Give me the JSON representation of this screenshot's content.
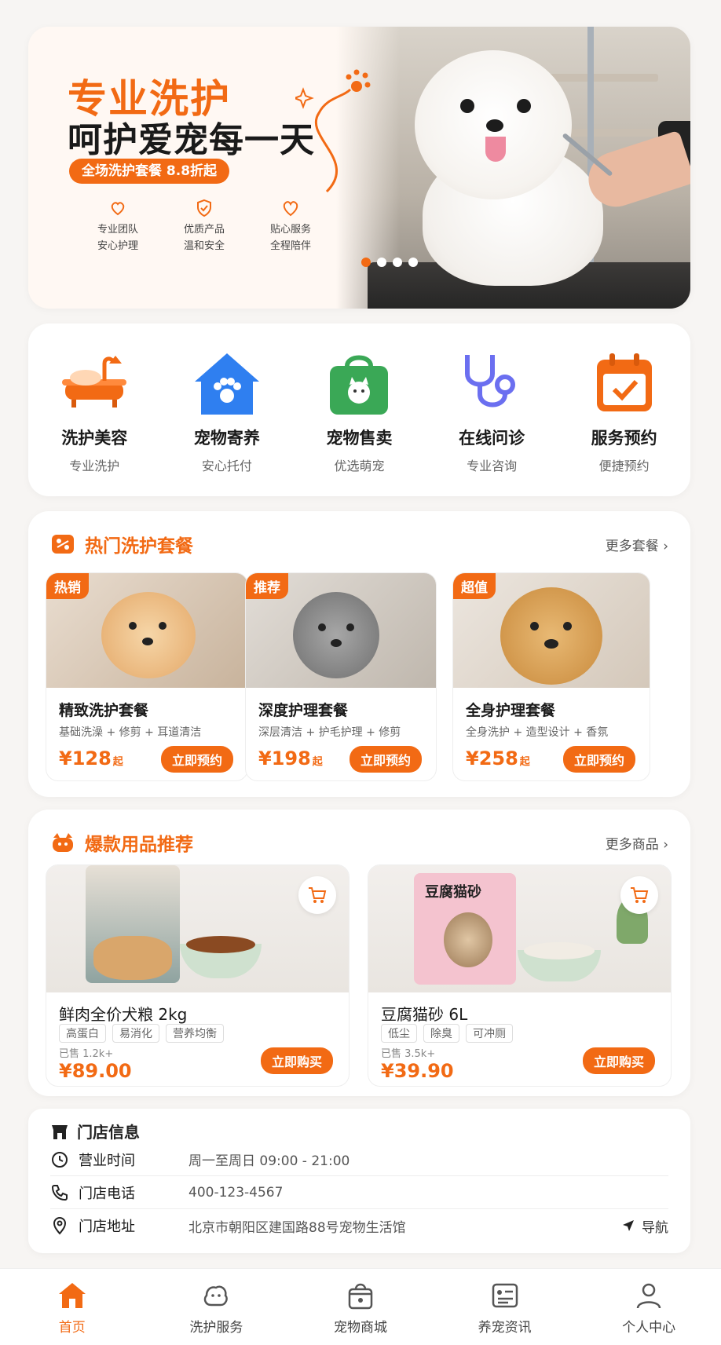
{
  "banner": {
    "title_line1": "专业洗护",
    "title_line2": "呵护爱宠每一天",
    "promo": "全场洗护套餐 8.8折起",
    "features": [
      {
        "icon": "heart-hand-icon",
        "line1": "专业团队",
        "line2": "安心护理"
      },
      {
        "icon": "shield-check-icon",
        "line1": "优质产品",
        "line2": "温和安全"
      },
      {
        "icon": "heart-icon",
        "line1": "贴心服务",
        "line2": "全程陪伴"
      }
    ],
    "slide_count": 4,
    "active_slide": 1
  },
  "categories": [
    {
      "icon": "bathtub-icon",
      "title": "洗护美容",
      "subtitle": "专业洗护"
    },
    {
      "icon": "pet-house-icon",
      "title": "宠物寄养",
      "subtitle": "安心托付"
    },
    {
      "icon": "pet-shop-bag-icon",
      "title": "宠物售卖",
      "subtitle": "优选萌宠"
    },
    {
      "icon": "stethoscope-icon",
      "title": "在线问诊",
      "subtitle": "专业咨询"
    },
    {
      "icon": "calendar-check-icon",
      "title": "服务预约",
      "subtitle": "便捷预约"
    }
  ],
  "packages_section": {
    "title": "热门洗护套餐",
    "more": "更多套餐",
    "items": [
      {
        "tag": "热销",
        "name": "精致洗护套餐",
        "desc": "基础洗澡 + 修剪 + 耳道清洁",
        "price": "¥128",
        "price_suffix": "起",
        "button": "立即预约"
      },
      {
        "tag": "推荐",
        "name": "深度护理套餐",
        "desc": "深层清洁 + 护毛护理 + 修剪",
        "price": "¥198",
        "price_suffix": "起",
        "button": "立即预约"
      },
      {
        "tag": "超值",
        "name": "全身护理套餐",
        "desc": "全身洗护 + 造型设计 + 香氛",
        "price": "¥258",
        "price_suffix": "起",
        "button": "立即预约"
      }
    ]
  },
  "products_section": {
    "title": "爆款用品推荐",
    "more": "更多商品",
    "items": [
      {
        "name": "鲜肉全价犬粮 2kg",
        "tags": [
          "高蛋白",
          "易消化",
          "营养均衡"
        ],
        "sold": "已售 1.2k+",
        "price": "¥89.00",
        "button": "立即购买"
      },
      {
        "name": "豆腐猫砂 6L",
        "tags": [
          "低尘",
          "除臭",
          "可冲厕"
        ],
        "sold": "已售 3.5k+",
        "price": "¥39.90",
        "button": "立即购买",
        "package_text": "豆腐猫砂"
      }
    ]
  },
  "store": {
    "title": "门店信息",
    "hours_label": "营业时间",
    "hours_value": "周一至周日  09:00 - 21:00",
    "phone_label": "门店电话",
    "phone_value": "400-123-4567",
    "address_label": "门店地址",
    "address_value": "北京市朝阳区建国路88号宠物生活馆",
    "navigate": "导航"
  },
  "tabbar": [
    {
      "icon": "home-icon",
      "label": "首页",
      "active": true
    },
    {
      "icon": "grooming-icon",
      "label": "洗护服务",
      "active": false
    },
    {
      "icon": "shop-icon",
      "label": "宠物商城",
      "active": false
    },
    {
      "icon": "news-icon",
      "label": "养宠资讯",
      "active": false
    },
    {
      "icon": "user-icon",
      "label": "个人中心",
      "active": false
    }
  ],
  "colors": {
    "accent": "#f26a14",
    "text": "#1a1a1a",
    "muted": "#666666",
    "background": "#f7f5f3"
  }
}
